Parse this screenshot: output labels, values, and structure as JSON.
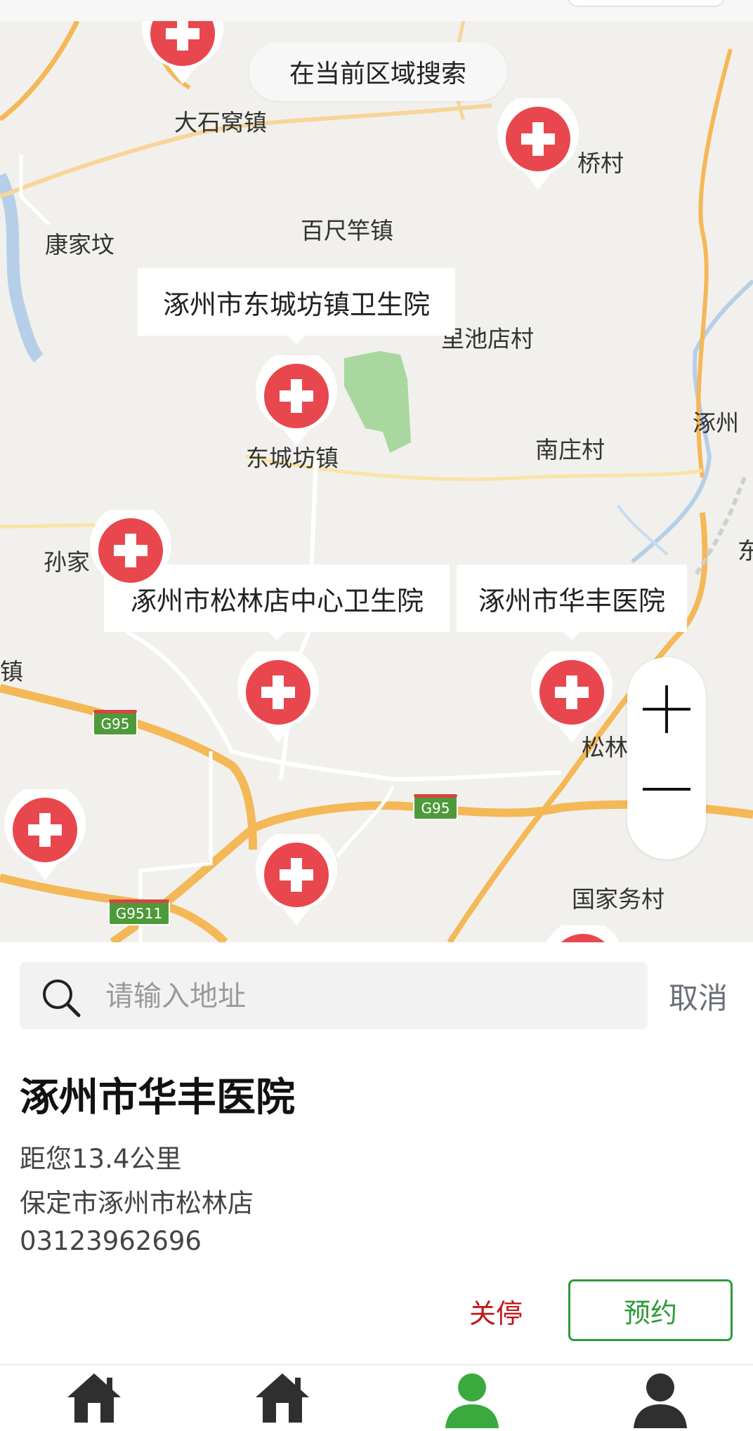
{
  "map": {
    "search_area_label": "在当前区域搜索",
    "places": [
      "大石窝镇",
      "桥村",
      "康家坟",
      "百尺竿镇",
      "里池店村",
      "涿州",
      "东城坊镇",
      "南庄村",
      "孙家",
      "东",
      "镇",
      "松林",
      "国家务村"
    ],
    "callouts": [
      "涿州市东城坊镇卫生院",
      "涿州市松林店中心卫生院",
      "涿州市华丰医院"
    ],
    "road_shields": [
      "G95",
      "G95",
      "G9511"
    ],
    "zoom_in": "+",
    "zoom_out": "−"
  },
  "search": {
    "placeholder": "请输入地址",
    "cancel_label": "取消"
  },
  "hospital": {
    "name": "涿州市华丰医院",
    "distance": "距您13.4公里",
    "address": "保定市涿州市松林店",
    "phone": "03123962696",
    "status_label": "关停",
    "book_label": "预约"
  },
  "tabbar": {
    "tabs": [
      {
        "icon": "home-icon",
        "active": false
      },
      {
        "icon": "home-icon",
        "active": false
      },
      {
        "icon": "person-icon",
        "active": true
      },
      {
        "icon": "person-icon",
        "active": false
      }
    ]
  },
  "colors": {
    "pin": "#e8474e",
    "accent_green": "#2e9b3a",
    "status_red": "#c0171b",
    "road_orange": "#f4b857"
  }
}
